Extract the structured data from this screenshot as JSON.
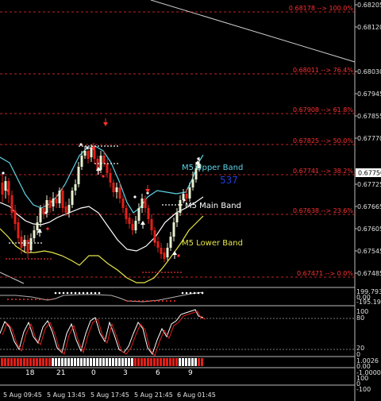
{
  "price_axis": {
    "ticks": [
      "0.68205",
      "0.68120",
      "0.68030",
      "0.67945",
      "0.67855",
      "0.67770",
      "0.67685",
      "0.67595",
      "0.67510"
    ],
    "current_price": "0.67750",
    "ticks_lower": [
      "0.67725",
      "0.67665",
      "0.67605",
      "0.67545",
      "0.67485"
    ]
  },
  "fib_levels": [
    {
      "label": "0.68178 --> 100.0%"
    },
    {
      "label": "0.68011 --> 76.4%"
    },
    {
      "label": "0.67908 --> 61.8%"
    },
    {
      "label": "0.67825 --> 50.0%"
    },
    {
      "label": "0.67741 --> 38.2%"
    },
    {
      "label": "0.67638 --> 23.6%"
    },
    {
      "label": "0.67471 --> 0.0%"
    }
  ],
  "bands": {
    "upper_label": "M5 Upper Band",
    "main_label": "M5 Main Band",
    "lower_label": "M5 Lower Band",
    "upper_color": "#5fd3e6",
    "main_color": "#ffffff",
    "lower_color": "#e6e64a"
  },
  "countdown": "537",
  "sub1": {
    "labels": [
      "199.7937",
      "0.00",
      "-195.190"
    ]
  },
  "sub2": {
    "labels": [
      "100",
      "80",
      "20",
      "0"
    ]
  },
  "hist": {
    "labels": [
      "18",
      "21",
      "0",
      "3",
      "6",
      "9"
    ],
    "right_labels": [
      "1.0026",
      "0.00",
      "-1.0000"
    ]
  },
  "lowest": {
    "labels": [
      "100",
      "0",
      "-100"
    ]
  },
  "time_axis": {
    "labels": [
      "5 Aug 09:45",
      "5 Aug 13:45",
      "5 Aug 17:45",
      "5 Aug 21:45",
      "6 Aug 01:45"
    ]
  },
  "colors": {
    "bull": "#e8f0d0",
    "bear": "#e0201a",
    "fib": "#ff3030",
    "panel_line": "#b0b0b0"
  }
}
